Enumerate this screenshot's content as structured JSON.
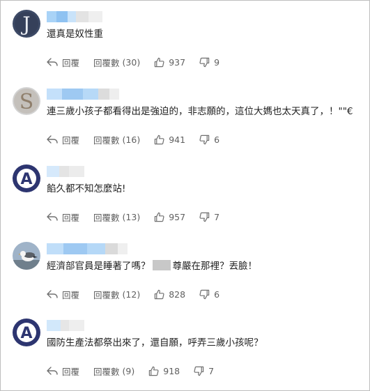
{
  "labels": {
    "reply": "回覆",
    "replies": "回覆數"
  },
  "comments": [
    {
      "text": "還真是奴性重",
      "reply_count": "(30)",
      "likes": "937",
      "dislikes": "9",
      "avatar": {
        "type": "letter",
        "letter": "J",
        "bg": "#3d4a66",
        "fg": "#e9ecf2"
      }
    },
    {
      "text": "連三歲小孩子都看得出是強迫的，非志願的，這位大媽也太天真了，！\"\"€",
      "reply_count": "(16)",
      "likes": "941",
      "dislikes": "6",
      "avatar": {
        "type": "letter",
        "letter": "S",
        "bg": "#cfcfcf",
        "fg": "#9a8a78"
      }
    },
    {
      "text": "餡久都不知怎麼站!",
      "reply_count": "(13)",
      "likes": "957",
      "dislikes": "7",
      "avatar": {
        "type": "letter",
        "letter": "A",
        "bg": "#2d3570",
        "fg": "#ffffff"
      }
    },
    {
      "text_before": "經濟部官員是睡著了嗎？",
      "text_after": "尊嚴在那裡？丟臉！",
      "reply_count": "(12)",
      "likes": "828",
      "dislikes": "6",
      "avatar": {
        "type": "bird",
        "bg": "#9fb3c8"
      }
    },
    {
      "text": "國防生產法都祭出來了，還自願，呼弄三歲小孩呢？",
      "reply_count": "(9)",
      "likes": "918",
      "dislikes": "7",
      "avatar": {
        "type": "letter",
        "letter": "A",
        "bg": "#2d3570",
        "fg": "#ffffff"
      }
    }
  ],
  "colors": {
    "text": "#1f1f1f",
    "meta": "#606060",
    "border": "#bdbdbd",
    "blur_blue": "#9ec9f2",
    "redaction": "#c8c8c8"
  }
}
